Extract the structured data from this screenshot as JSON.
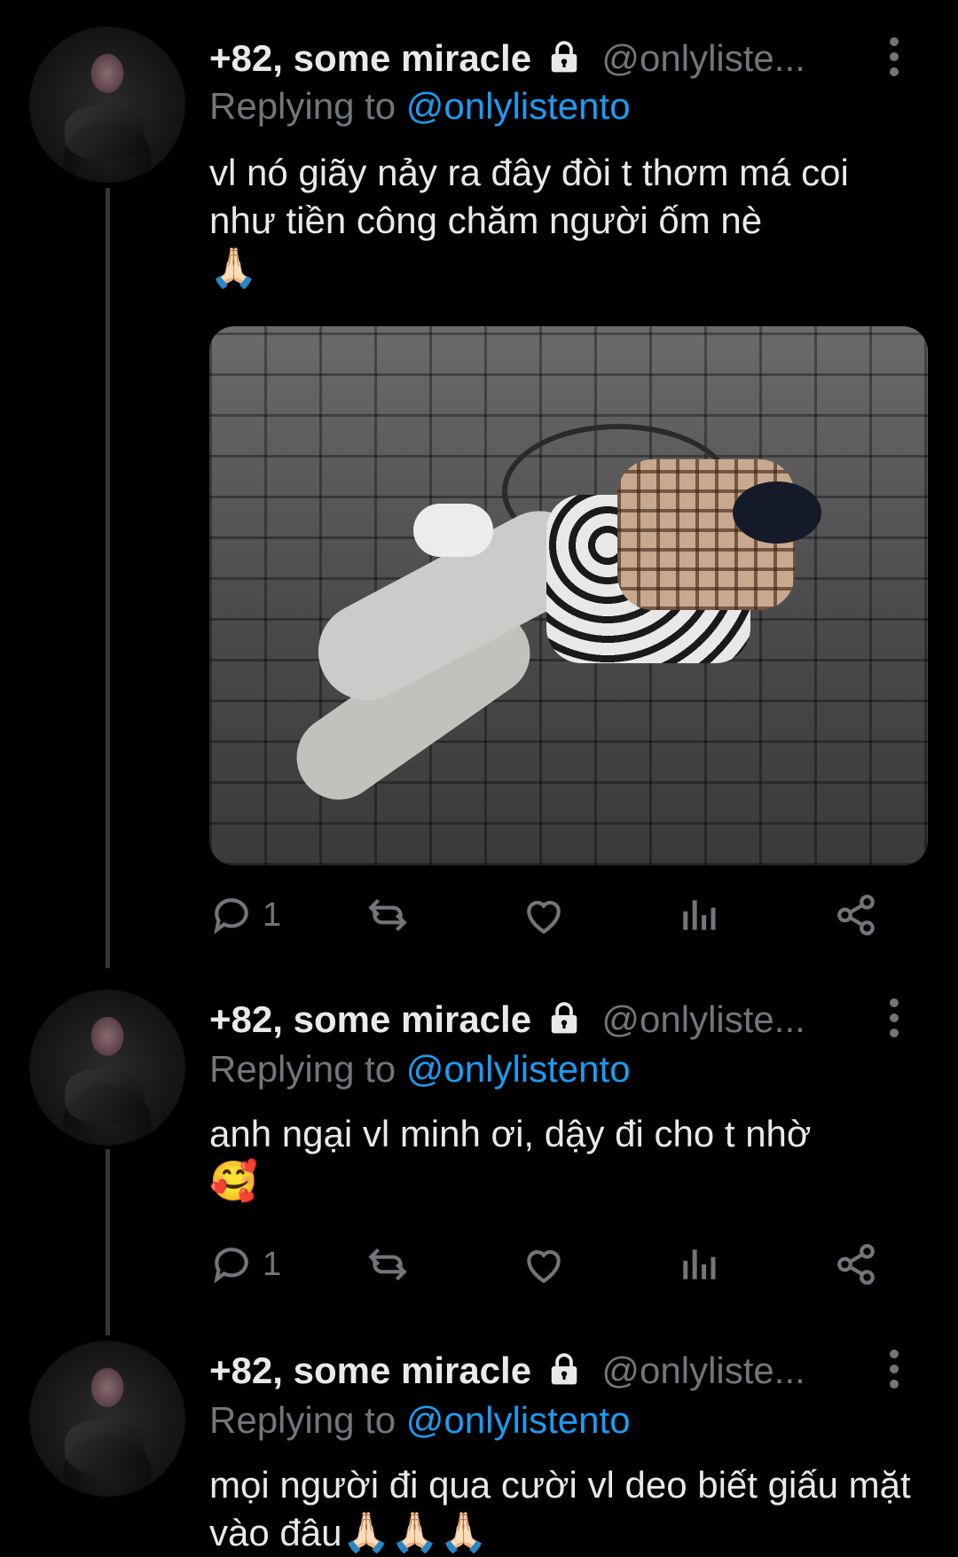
{
  "tweets": [
    {
      "name": "+82, some miracle",
      "handle": "@onlyliste...",
      "replying_label": "Replying to",
      "replying_to": "@onlylistento",
      "text": "vl nó giãy nảy ra đây đòi t thơm má coi như tiền công chăm người ốm nè",
      "emoji": "🙏🏻",
      "has_media": true,
      "reply_count": "1"
    },
    {
      "name": "+82, some miracle",
      "handle": "@onlyliste...",
      "replying_label": "Replying to",
      "replying_to": "@onlylistento",
      "text": "anh ngại vl minh ơi, dậy đi cho t nhờ",
      "emoji": "🥰",
      "has_media": false,
      "reply_count": "1"
    },
    {
      "name": "+82, some miracle",
      "handle": "@onlyliste...",
      "replying_label": "Replying to",
      "replying_to": "@onlylistento",
      "text": "mọi người đi qua cười vl deo biết giấu mặt vào đâu",
      "emoji": "🙏🏻🙏🏻🙏🏻",
      "has_media": false,
      "reply_count": ""
    }
  ],
  "icons": {
    "lock": "lock-icon",
    "more": "more-vertical-icon",
    "reply": "reply-icon",
    "retweet": "retweet-icon",
    "like": "heart-icon",
    "views": "analytics-icon",
    "share": "share-icon"
  },
  "colors": {
    "background": "#000000",
    "text": "#e7e9ea",
    "muted": "#71767b",
    "link": "#1d9bf0"
  }
}
